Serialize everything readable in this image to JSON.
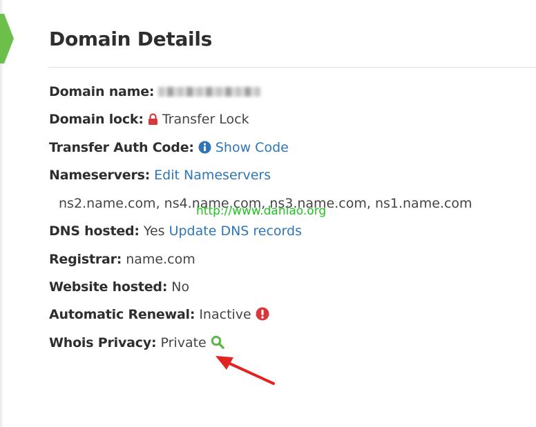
{
  "page": {
    "title": "Domain Details"
  },
  "details": {
    "domain_name": {
      "label": "Domain name:"
    },
    "domain_lock": {
      "label": "Domain lock:",
      "value": "Transfer Lock",
      "icon": "lock-icon"
    },
    "transfer_auth": {
      "label": "Transfer Auth Code:",
      "link": "Show Code",
      "icon": "info-icon"
    },
    "nameservers": {
      "label": "Nameservers:",
      "link": "Edit Nameservers",
      "list": "ns2.name.com, ns4.name.com, ns3.name.com, ns1.name.com"
    },
    "dns_hosted": {
      "label": "DNS hosted:",
      "value": "Yes",
      "link": "Update DNS records"
    },
    "registrar": {
      "label": "Registrar:",
      "value": "name.com"
    },
    "website_hosted": {
      "label": "Website hosted:",
      "value": "No"
    },
    "auto_renewal": {
      "label": "Automatic Renewal:",
      "value": "Inactive",
      "icon": "alert-icon"
    },
    "whois_privacy": {
      "label": "Whois Privacy:",
      "value": "Private",
      "icon": "search-icon"
    }
  },
  "watermark": "http://www.daniao.org",
  "colors": {
    "link": "#2f75b5",
    "lock": "#d9383a",
    "info": "#2f75b5",
    "alert": "#d9383a",
    "search": "#5db54a",
    "chevron": "#6cbf4a",
    "arrow": "#e32222",
    "watermark": "#19c419"
  }
}
